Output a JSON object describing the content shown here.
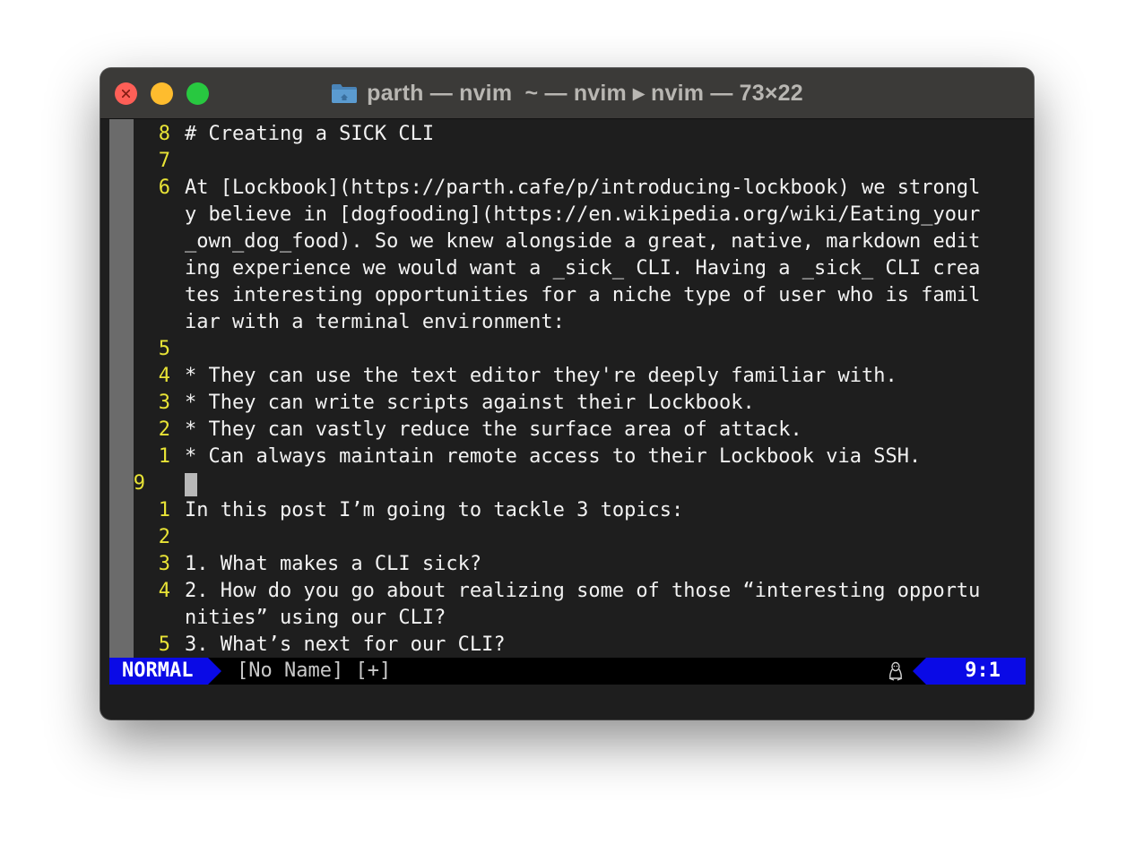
{
  "window": {
    "title": "parth — nvim  ~ — nvim ▸ nvim — 73×22",
    "folder_icon": "folder-icon"
  },
  "editor": {
    "rows": [
      {
        "num": "8",
        "text": "# Creating a SICK CLI"
      },
      {
        "num": "7",
        "text": ""
      },
      {
        "num": "6",
        "text": "At [Lockbook](https://parth.cafe/p/introducing-lockbook) we strongl"
      },
      {
        "num": "",
        "text": "y believe in [dogfooding](https://en.wikipedia.org/wiki/Eating_your"
      },
      {
        "num": "",
        "text": "_own_dog_food). So we knew alongside a great, native, markdown edit"
      },
      {
        "num": "",
        "text": "ing experience we would want a _sick_ CLI. Having a _sick_ CLI crea"
      },
      {
        "num": "",
        "text": "tes interesting opportunities for a niche type of user who is famil"
      },
      {
        "num": "",
        "text": "iar with a terminal environment:"
      },
      {
        "num": "5",
        "text": ""
      },
      {
        "num": "4",
        "text": "* They can use the text editor they're deeply familiar with."
      },
      {
        "num": "3",
        "text": "* They can write scripts against their Lockbook."
      },
      {
        "num": "2",
        "text": "* They can vastly reduce the surface area of attack."
      },
      {
        "num": "1",
        "text": "* Can always maintain remote access to their Lockbook via SSH."
      },
      {
        "num": "9",
        "text": "",
        "current": true
      },
      {
        "num": "1",
        "text": "In this post I’m going to tackle 3 topics:"
      },
      {
        "num": "2",
        "text": ""
      },
      {
        "num": "3",
        "text": "1. What makes a CLI sick?"
      },
      {
        "num": "4",
        "text": "2. How do you go about realizing some of those “interesting opportu"
      },
      {
        "num": "",
        "text": "nities” using our CLI?"
      },
      {
        "num": "5",
        "text": "3. What’s next for our CLI?"
      }
    ]
  },
  "statusline": {
    "mode": "NORMAL",
    "file": "[No Name] [+]",
    "os_icon": "linux-penguin-icon",
    "position": "9:1"
  },
  "colors": {
    "line_number": "#e8e336",
    "mode_bg": "#0a0ae6",
    "text": "#f2f2f2",
    "terminal_bg": "#1e1e1e"
  }
}
